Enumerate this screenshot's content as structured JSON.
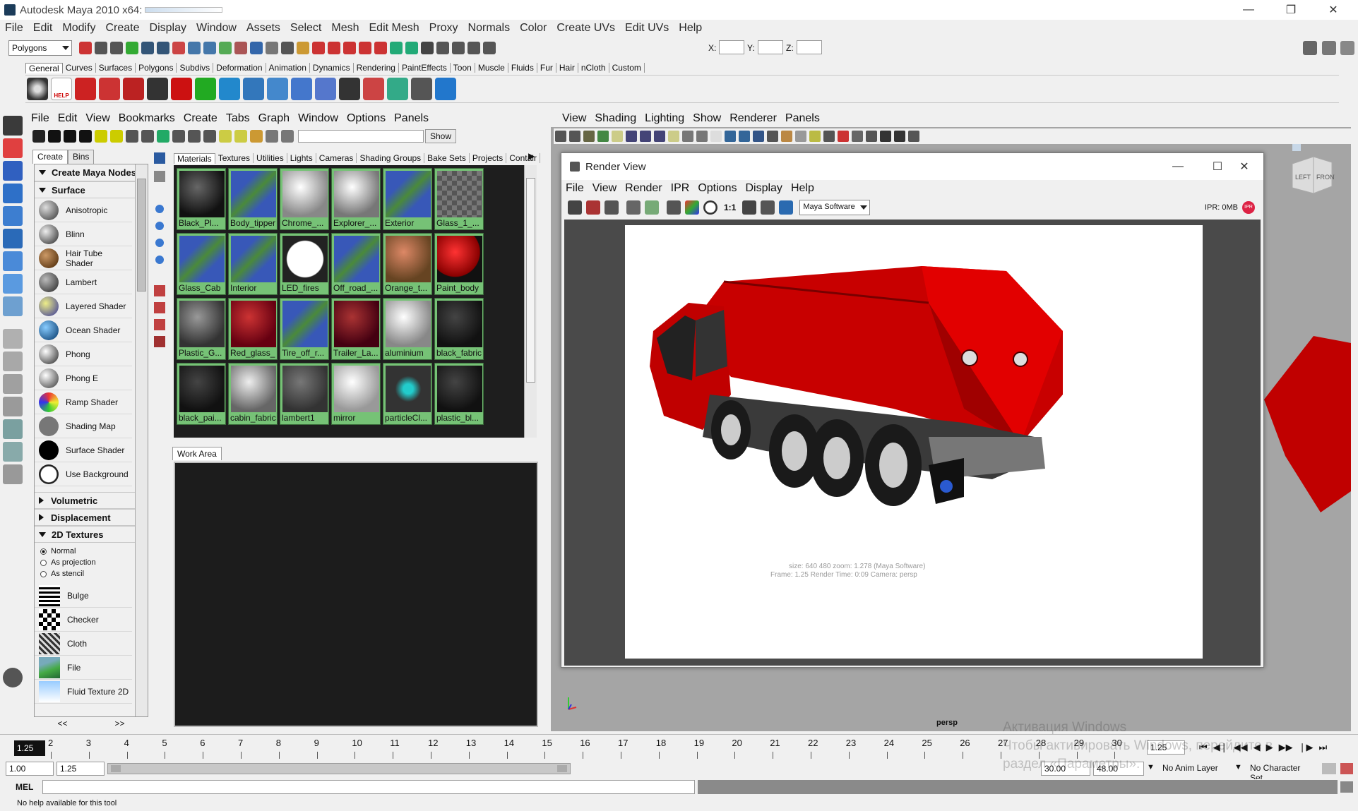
{
  "window": {
    "title": "Autodesk Maya 2010 x64:"
  },
  "main_menu": [
    "File",
    "Edit",
    "Modify",
    "Create",
    "Display",
    "Window",
    "Assets",
    "Select",
    "Mesh",
    "Edit Mesh",
    "Proxy",
    "Normals",
    "Color",
    "Create UVs",
    "Edit UVs",
    "Help"
  ],
  "status_line": {
    "mode": "Polygons",
    "x_label": "X:",
    "y_label": "Y:",
    "z_label": "Z:"
  },
  "shelf_tabs": [
    "General",
    "Curves",
    "Surfaces",
    "Polygons",
    "Subdivs",
    "Deformation",
    "Animation",
    "Dynamics",
    "Rendering",
    "PaintEffects",
    "Toon",
    "Muscle",
    "Fluids",
    "Fur",
    "Hair",
    "nCloth",
    "Custom"
  ],
  "shelf": {
    "help_label": "HELP"
  },
  "hypershade": {
    "menu": [
      "File",
      "Edit",
      "View",
      "Bookmarks",
      "Create",
      "Tabs",
      "Graph",
      "Window",
      "Options",
      "Panels"
    ],
    "show_label": "Show",
    "create_tabs": [
      "Create",
      "Bins"
    ],
    "create_header": "Create Maya Nodes",
    "surface_section": "Surface",
    "surface_items": [
      "Anisotropic",
      "Blinn",
      "Hair Tube Shader",
      "Lambert",
      "Layered Shader",
      "Ocean Shader",
      "Phong",
      "Phong E",
      "Ramp Shader",
      "Shading Map",
      "Surface Shader",
      "Use Background"
    ],
    "collapsed_sections": [
      "Volumetric",
      "Displacement"
    ],
    "textures_section": "2D Textures",
    "texture_modes": [
      "Normal",
      "As projection",
      "As stencil"
    ],
    "texture_items": [
      "Bulge",
      "Checker",
      "Cloth",
      "File",
      "Fluid Texture 2D"
    ],
    "scroll_buttons": [
      "<<",
      ">>"
    ],
    "material_tabs": [
      "Materials",
      "Textures",
      "Utilities",
      "Lights",
      "Cameras",
      "Shading Groups",
      "Bake Sets",
      "Projects",
      "Contair"
    ],
    "materials": [
      "Black_Pl...",
      "Body_tipper",
      "Chrome_...",
      "Explorer_...",
      "Exterior",
      "Glass_1_...",
      "Glass_Cab",
      "Interior",
      "LED_fires",
      "Off_road_...",
      "Orange_t...",
      "Paint_body",
      "Plastic_G...",
      "Red_glass_",
      "Tire_off_r...",
      "Trailer_La...",
      "aluminium",
      "black_fabric",
      "black_pai...",
      "cabin_fabric",
      "lambert1",
      "mirror",
      "particleCl...",
      "plastic_bl..."
    ],
    "work_area_tab": "Work Area"
  },
  "viewport": {
    "menu": [
      "View",
      "Shading",
      "Lighting",
      "Show",
      "Renderer",
      "Panels"
    ],
    "camera_label": "persp",
    "viewcube": {
      "left": "LEFT",
      "front": "FRONT"
    }
  },
  "render_view": {
    "title": "Render View",
    "menu": [
      "File",
      "View",
      "Render",
      "IPR",
      "Options",
      "Display",
      "Help"
    ],
    "renderer": "Maya Software",
    "ratio_label": "1:1",
    "ipr_status": "IPR: 0MB",
    "ipr_badge": "IPR",
    "info_line1": "size:  640  480 zoom: 1.278      (Maya Software)",
    "info_line2": "Frame: 1.25      Render Time: 0:09      Camera: persp"
  },
  "timeline": {
    "current_frame": "1.25",
    "ticks": [
      "2",
      "3",
      "4",
      "5",
      "6",
      "7",
      "8",
      "9",
      "10",
      "11",
      "12",
      "13",
      "14",
      "15",
      "16",
      "17",
      "18",
      "19",
      "20",
      "21",
      "22",
      "23",
      "24",
      "25",
      "26",
      "27",
      "28",
      "29",
      "30"
    ],
    "current_time_field": "1.25"
  },
  "range_slider": {
    "start": "1.00",
    "playback_start": "1.25",
    "playback_end": "30.00",
    "end": "48.00",
    "anim_layer": "No Anim Layer",
    "character_set": "No Character Set"
  },
  "command_line": {
    "label": "MEL"
  },
  "help_line": {
    "text": "No help available for this tool"
  },
  "watermark": {
    "line1": "Активация Windows",
    "line2": "Чтобы активировать Windows, перейдите в",
    "line3": "раздел «Параметры»."
  }
}
